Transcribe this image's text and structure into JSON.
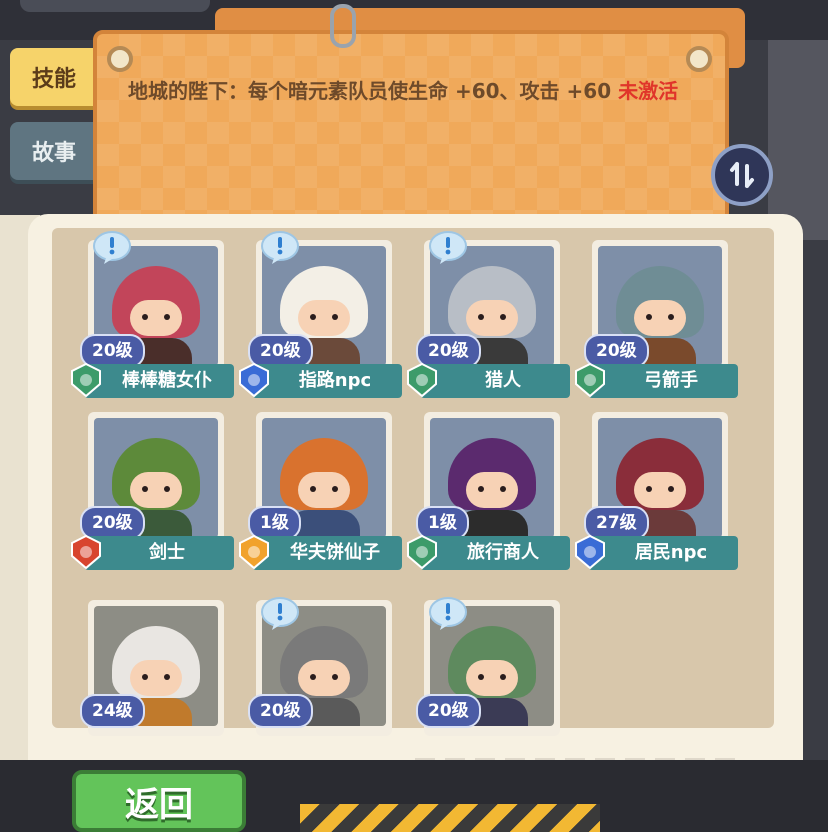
{
  "tabs": {
    "skill": "技能",
    "story": "故事"
  },
  "skill": {
    "text": "地城的陛下：每个暗元素队员使生命 +60、攻击 +60",
    "status": "未激活"
  },
  "back_button": "返回",
  "colors": {
    "inactive": "#e0352a",
    "badge_green": "#3c9b6a",
    "badge_blue": "#3a6cd6",
    "badge_red": "#d8452e",
    "badge_orange": "#f1a22c"
  },
  "characters": [
    {
      "name": "棒棒糖女仆",
      "level": "20级",
      "badge": "green",
      "new": true
    },
    {
      "name": "指路npc",
      "level": "20级",
      "badge": "blue",
      "new": true
    },
    {
      "name": "猎人",
      "level": "20级",
      "badge": "green",
      "new": true
    },
    {
      "name": "弓箭手",
      "level": "20级",
      "badge": "green",
      "new": false
    },
    {
      "name": "剑士",
      "level": "20级",
      "badge": "red",
      "new": false
    },
    {
      "name": "华夫饼仙子",
      "level": "1级",
      "badge": "orange",
      "new": false
    },
    {
      "name": "旅行商人",
      "level": "1级",
      "badge": "green",
      "new": false
    },
    {
      "name": "居民npc",
      "level": "27级",
      "badge": "blue",
      "new": false
    },
    {
      "name": "",
      "level": "24级",
      "badge": "",
      "new": false
    },
    {
      "name": "",
      "level": "20级",
      "badge": "",
      "new": true
    },
    {
      "name": "",
      "level": "20级",
      "badge": "",
      "new": true
    }
  ]
}
